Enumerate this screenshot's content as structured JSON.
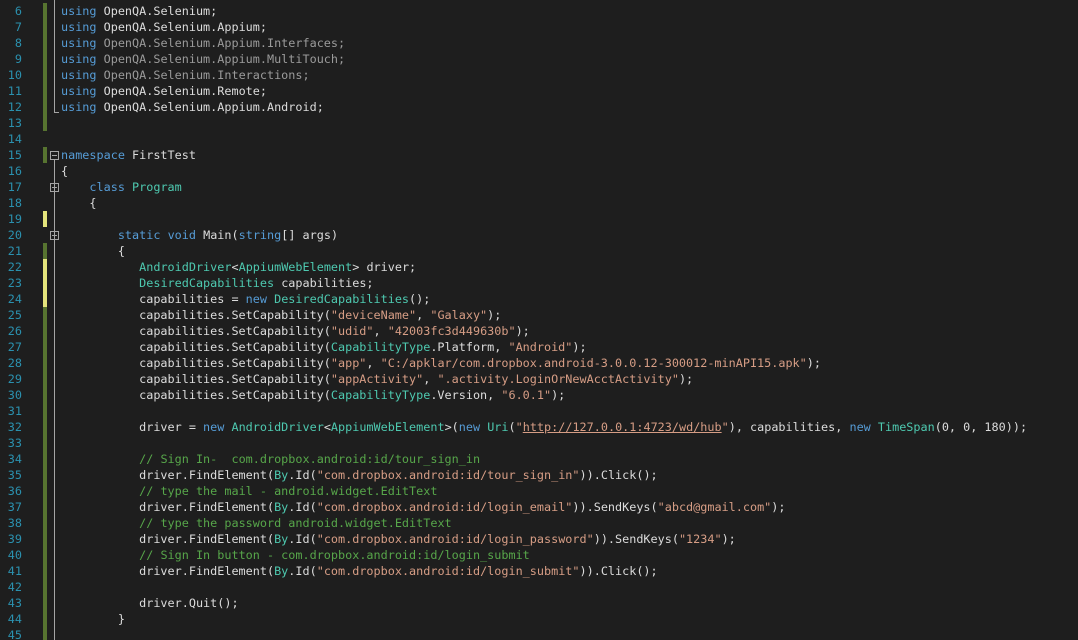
{
  "editor": {
    "lines": [
      {
        "n": "6",
        "mark": "saved",
        "fold": "",
        "tokens": [
          [
            "kw",
            "using"
          ],
          [
            "",
            "OpenQA.Selenium;"
          ]
        ]
      },
      {
        "n": "7",
        "mark": "saved",
        "fold": "",
        "tokens": [
          [
            "kw",
            "using"
          ],
          [
            "",
            "OpenQA.Selenium.Appium;"
          ]
        ]
      },
      {
        "n": "8",
        "mark": "saved",
        "fold": "",
        "tokens": [
          [
            "kw",
            "using"
          ],
          [
            "dim",
            "OpenQA.Selenium.Appium.Interfaces;"
          ]
        ]
      },
      {
        "n": "9",
        "mark": "saved",
        "fold": "",
        "tokens": [
          [
            "kw",
            "using"
          ],
          [
            "dim",
            "OpenQA.Selenium.Appium.MultiTouch;"
          ]
        ]
      },
      {
        "n": "10",
        "mark": "saved",
        "fold": "",
        "tokens": [
          [
            "kw",
            "using"
          ],
          [
            "dim",
            "OpenQA.Selenium.Interactions;"
          ]
        ]
      },
      {
        "n": "11",
        "mark": "saved",
        "fold": "",
        "tokens": [
          [
            "kw",
            "using"
          ],
          [
            "",
            "OpenQA.Selenium.Remote;"
          ]
        ]
      },
      {
        "n": "12",
        "mark": "saved",
        "fold": "",
        "tokens": [
          [
            "kw",
            "using"
          ],
          [
            "",
            "OpenQA.Selenium.Appium.Android;"
          ]
        ]
      },
      {
        "n": "13",
        "mark": "saved",
        "fold": "",
        "tokens": []
      },
      {
        "n": "14",
        "mark": "",
        "fold": "",
        "tokens": []
      },
      {
        "n": "15",
        "mark": "saved",
        "fold": "minus",
        "tokens": [
          [
            "kw",
            "namespace"
          ],
          [
            "",
            " FirstTest"
          ]
        ]
      },
      {
        "n": "16",
        "mark": "",
        "fold": "",
        "tokens": [
          [
            "",
            "{"
          ]
        ]
      },
      {
        "n": "17",
        "mark": "",
        "fold": "minus",
        "tokens": [
          [
            "",
            "    "
          ],
          [
            "kw",
            "class"
          ],
          [
            "",
            " "
          ],
          [
            "ty",
            "Program"
          ]
        ]
      },
      {
        "n": "18",
        "mark": "",
        "fold": "",
        "tokens": [
          [
            "",
            "    {"
          ]
        ]
      },
      {
        "n": "19",
        "mark": "unsaved",
        "fold": "",
        "tokens": []
      },
      {
        "n": "20",
        "mark": "",
        "fold": "minus",
        "tokens": [
          [
            "",
            "        "
          ],
          [
            "kw",
            "static"
          ],
          [
            "",
            " "
          ],
          [
            "kw",
            "void"
          ],
          [
            "",
            " Main("
          ],
          [
            "kw",
            "string"
          ],
          [
            "",
            "[] args)"
          ]
        ]
      },
      {
        "n": "21",
        "mark": "saved",
        "fold": "",
        "tokens": [
          [
            "",
            "        {"
          ]
        ]
      },
      {
        "n": "22",
        "mark": "unsaved",
        "fold": "",
        "tokens": [
          [
            "",
            "           "
          ],
          [
            "ty",
            "AndroidDriver"
          ],
          [
            "",
            "<"
          ],
          [
            "ty",
            "AppiumWebElement"
          ],
          [
            "",
            "> driver;"
          ]
        ]
      },
      {
        "n": "23",
        "mark": "unsaved",
        "fold": "",
        "tokens": [
          [
            "",
            "           "
          ],
          [
            "ty",
            "DesiredCapabilities"
          ],
          [
            "",
            " capabilities;"
          ]
        ]
      },
      {
        "n": "24",
        "mark": "unsaved",
        "fold": "",
        "tokens": [
          [
            "",
            "           capabilities = "
          ],
          [
            "kw",
            "new"
          ],
          [
            "",
            " "
          ],
          [
            "ty",
            "DesiredCapabilities"
          ],
          [
            "",
            "();"
          ]
        ]
      },
      {
        "n": "25",
        "mark": "saved",
        "fold": "",
        "tokens": [
          [
            "",
            "           capabilities.SetCapability("
          ],
          [
            "st",
            "\"deviceName\""
          ],
          [
            "",
            ", "
          ],
          [
            "st",
            "\"Galaxy\""
          ],
          [
            "",
            ");"
          ]
        ]
      },
      {
        "n": "26",
        "mark": "saved",
        "fold": "",
        "tokens": [
          [
            "",
            "           capabilities.SetCapability("
          ],
          [
            "st",
            "\"udid\""
          ],
          [
            "",
            ", "
          ],
          [
            "st",
            "\"42003fc3d449630b\""
          ],
          [
            "",
            ");"
          ]
        ]
      },
      {
        "n": "27",
        "mark": "saved",
        "fold": "",
        "tokens": [
          [
            "",
            "           capabilities.SetCapability("
          ],
          [
            "ty",
            "CapabilityType"
          ],
          [
            "",
            ".Platform, "
          ],
          [
            "st",
            "\"Android\""
          ],
          [
            "",
            ");"
          ]
        ]
      },
      {
        "n": "28",
        "mark": "saved",
        "fold": "",
        "tokens": [
          [
            "",
            "           capabilities.SetCapability("
          ],
          [
            "st",
            "\"app\""
          ],
          [
            "",
            ", "
          ],
          [
            "st",
            "\"C:/apklar/com.dropbox.android-3.0.0.12-300012-minAPI15.apk\""
          ],
          [
            "",
            ");"
          ]
        ]
      },
      {
        "n": "29",
        "mark": "saved",
        "fold": "",
        "tokens": [
          [
            "",
            "           capabilities.SetCapability("
          ],
          [
            "st",
            "\"appActivity\""
          ],
          [
            "",
            ", "
          ],
          [
            "st",
            "\".activity.LoginOrNewAcctActivity\""
          ],
          [
            "",
            ");"
          ]
        ]
      },
      {
        "n": "30",
        "mark": "saved",
        "fold": "",
        "tokens": [
          [
            "",
            "           capabilities.SetCapability("
          ],
          [
            "ty",
            "CapabilityType"
          ],
          [
            "",
            ".Version, "
          ],
          [
            "st",
            "\"6.0.1\""
          ],
          [
            "",
            ");"
          ]
        ]
      },
      {
        "n": "31",
        "mark": "saved",
        "fold": "",
        "tokens": []
      },
      {
        "n": "32",
        "mark": "saved",
        "fold": "",
        "tokens": [
          [
            "",
            "           driver = "
          ],
          [
            "kw",
            "new"
          ],
          [
            "",
            " "
          ],
          [
            "ty",
            "AndroidDriver"
          ],
          [
            "",
            "<"
          ],
          [
            "ty",
            "AppiumWebElement"
          ],
          [
            "",
            ">("
          ],
          [
            "kw",
            "new"
          ],
          [
            "",
            " "
          ],
          [
            "ty",
            "Uri"
          ],
          [
            "",
            "("
          ],
          [
            "st",
            "\""
          ],
          [
            "url",
            "http://127.0.0.1:4723/wd/hub"
          ],
          [
            "st",
            "\""
          ],
          [
            "",
            "), capabilities, "
          ],
          [
            "kw",
            "new"
          ],
          [
            "",
            " "
          ],
          [
            "ty",
            "TimeSpan"
          ],
          [
            "",
            "(0, 0, 180));"
          ]
        ]
      },
      {
        "n": "33",
        "mark": "saved",
        "fold": "",
        "tokens": []
      },
      {
        "n": "34",
        "mark": "saved",
        "fold": "",
        "tokens": [
          [
            "",
            "           "
          ],
          [
            "cm",
            "// Sign In-  com.dropbox.android:id/tour_sign_in"
          ]
        ]
      },
      {
        "n": "35",
        "mark": "saved",
        "fold": "",
        "tokens": [
          [
            "",
            "           driver.FindElement("
          ],
          [
            "ty",
            "By"
          ],
          [
            "",
            ".Id("
          ],
          [
            "st",
            "\"com.dropbox.android:id/tour_sign_in\""
          ],
          [
            "",
            "))"
          ],
          [
            "",
            ".Click();"
          ]
        ]
      },
      {
        "n": "36",
        "mark": "saved",
        "fold": "",
        "tokens": [
          [
            "",
            "           "
          ],
          [
            "cm",
            "// type the mail - android.widget.EditText"
          ]
        ]
      },
      {
        "n": "37",
        "mark": "saved",
        "fold": "",
        "tokens": [
          [
            "",
            "           driver.FindElement("
          ],
          [
            "ty",
            "By"
          ],
          [
            "",
            ".Id("
          ],
          [
            "st",
            "\"com.dropbox.android:id/login_email\""
          ],
          [
            "",
            ")).SendKeys("
          ],
          [
            "st",
            "\"abcd@gmail.com\""
          ],
          [
            "",
            ");"
          ]
        ]
      },
      {
        "n": "38",
        "mark": "saved",
        "fold": "",
        "tokens": [
          [
            "",
            "           "
          ],
          [
            "cm",
            "// type the password android.widget.EditText"
          ]
        ]
      },
      {
        "n": "39",
        "mark": "saved",
        "fold": "",
        "tokens": [
          [
            "",
            "           driver.FindElement("
          ],
          [
            "ty",
            "By"
          ],
          [
            "",
            ".Id("
          ],
          [
            "st",
            "\"com.dropbox.android:id/login_password\""
          ],
          [
            "",
            ")).SendKeys("
          ],
          [
            "st",
            "\"1234\""
          ],
          [
            "",
            ");"
          ]
        ]
      },
      {
        "n": "40",
        "mark": "saved",
        "fold": "",
        "tokens": [
          [
            "",
            "           "
          ],
          [
            "cm",
            "// Sign In button - com.dropbox.android:id/login_submit"
          ]
        ]
      },
      {
        "n": "41",
        "mark": "saved",
        "fold": "",
        "tokens": [
          [
            "",
            "           driver.FindElement("
          ],
          [
            "ty",
            "By"
          ],
          [
            "",
            ".Id("
          ],
          [
            "st",
            "\"com.dropbox.android:id/login_submit\""
          ],
          [
            "",
            ")).Click();"
          ]
        ]
      },
      {
        "n": "42",
        "mark": "saved",
        "fold": "",
        "tokens": []
      },
      {
        "n": "43",
        "mark": "saved",
        "fold": "",
        "tokens": [
          [
            "",
            "           driver.Quit();"
          ]
        ]
      },
      {
        "n": "44",
        "mark": "saved",
        "fold": "",
        "tokens": [
          [
            "",
            "        }"
          ]
        ]
      },
      {
        "n": "45",
        "mark": "saved",
        "fold": "",
        "tokens": []
      }
    ]
  },
  "colors": {
    "background": "#1e1e1e",
    "line_number": "#2b91af",
    "keyword": "#569cd6",
    "type": "#4ec9b0",
    "string": "#d69d85",
    "comment": "#57a64a",
    "change_saved": "#577430",
    "change_unsaved": "#e4e47c"
  }
}
